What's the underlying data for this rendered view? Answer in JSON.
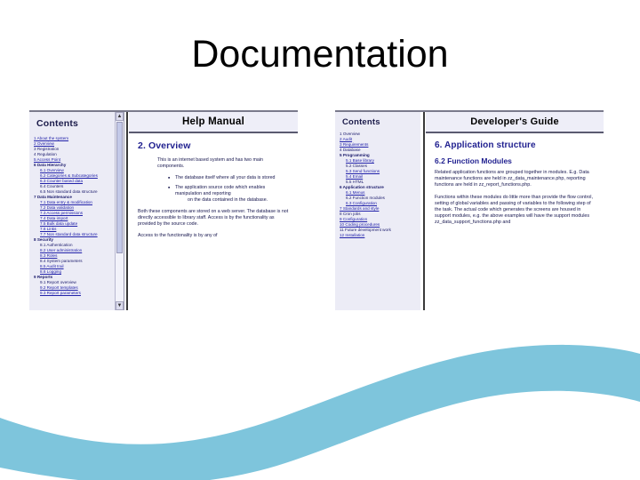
{
  "slide": {
    "title": "Documentation",
    "accent_color": "#7ec5dc",
    "heading_color": "#1f1f8f"
  },
  "left_screenshot": {
    "name": "help-manual-window",
    "sidebar": {
      "title": "Contents",
      "items": [
        {
          "label": "1 About the system",
          "link": true,
          "level": 1
        },
        {
          "label": "2 Overview",
          "link": true,
          "level": 1
        },
        {
          "label": "3 Registration",
          "link": false,
          "level": 1
        },
        {
          "label": "4 Regulation",
          "link": false,
          "level": 1
        },
        {
          "label": "5 Access Point",
          "link": true,
          "level": 1
        },
        {
          "label": "6 Data Hierarchy",
          "link": false,
          "level": 1,
          "header": true
        },
        {
          "label": "6.1 Overview",
          "link": true,
          "level": 2
        },
        {
          "label": "6.2 Categories & Subcategories",
          "link": true,
          "level": 2
        },
        {
          "label": "6.3 Counter based data",
          "link": true,
          "level": 2
        },
        {
          "label": "6.4 Counters",
          "link": false,
          "level": 2
        },
        {
          "label": "6.5 Non standard data structure",
          "link": false,
          "level": 2
        },
        {
          "label": "7 Data Maintenance",
          "link": false,
          "level": 1,
          "header": true
        },
        {
          "label": "7.1 Data entry & modification",
          "link": true,
          "level": 2
        },
        {
          "label": "7.2 Data validation",
          "link": true,
          "level": 2
        },
        {
          "label": "7.3 Access permissions",
          "link": true,
          "level": 2
        },
        {
          "label": "7.4 Data import",
          "link": true,
          "level": 2
        },
        {
          "label": "7.5 Bulk data update",
          "link": true,
          "level": 2
        },
        {
          "label": "7.6 Links",
          "link": true,
          "level": 2
        },
        {
          "label": "7.7 Non standard data structure",
          "link": true,
          "level": 2
        },
        {
          "label": "8 Security",
          "link": false,
          "level": 1,
          "header": true
        },
        {
          "label": "8.1 Authentication",
          "link": false,
          "level": 2
        },
        {
          "label": "8.2 User administration",
          "link": true,
          "level": 2
        },
        {
          "label": "8.3 Roles",
          "link": true,
          "level": 2
        },
        {
          "label": "8.4 System parameters",
          "link": false,
          "level": 2
        },
        {
          "label": "8.5 Audit trail",
          "link": true,
          "level": 2
        },
        {
          "label": "8.6 Logging",
          "link": true,
          "level": 2
        },
        {
          "label": "9 Reports",
          "link": false,
          "level": 1,
          "header": true
        },
        {
          "label": "9.1 Report overview",
          "link": false,
          "level": 2
        },
        {
          "label": "9.2 Report templates",
          "link": true,
          "level": 2
        },
        {
          "label": "9.3 Report parameters",
          "link": true,
          "level": 2
        }
      ]
    },
    "header_title": "Help Manual",
    "section_title": "2. Overview",
    "intro": "This is an internet based system and has two main components.",
    "bullets": [
      {
        "text": "The database itself where all your data is stored"
      },
      {
        "text": "The application source code which enables manipulation and reporting",
        "indent": "on the data contained in the database."
      }
    ],
    "paragraphs": [
      "Both these components are stored on a web server. The database is not directly accessible to library staff. Access is by the functionality as provided by the source code.",
      "Access to the functionality is by any of"
    ],
    "scrollbar": {
      "up": "▲",
      "down": "▼"
    }
  },
  "right_screenshot": {
    "name": "developers-guide-window",
    "sidebar": {
      "title": "Contents",
      "items": [
        {
          "label": "1 Overview",
          "link": false,
          "level": 1
        },
        {
          "label": "2 Audit",
          "link": true,
          "level": 1
        },
        {
          "label": "3 Requirements",
          "link": true,
          "level": 1
        },
        {
          "label": "4 Database",
          "link": false,
          "level": 1
        },
        {
          "label": "5 Programming",
          "link": false,
          "level": 1,
          "header": true
        },
        {
          "label": "5.1 Base library",
          "link": true,
          "level": 2
        },
        {
          "label": "5.2 Classes",
          "link": false,
          "level": 2
        },
        {
          "label": "5.3 Send functions",
          "link": true,
          "level": 2
        },
        {
          "label": "5.4 Email",
          "link": true,
          "level": 2
        },
        {
          "label": "5.5 HTML",
          "link": false,
          "level": 2
        },
        {
          "label": "6 Application structure",
          "link": false,
          "level": 1,
          "header": true
        },
        {
          "label": "6.1 Menus",
          "link": true,
          "level": 2
        },
        {
          "label": "6.2 Function modules",
          "link": false,
          "level": 2
        },
        {
          "label": "6.3 Configuration",
          "link": true,
          "level": 2
        },
        {
          "label": "7 Standards and style",
          "link": true,
          "level": 1
        },
        {
          "label": "8 Cron jobs",
          "link": false,
          "level": 1
        },
        {
          "label": "9 Configuration",
          "link": true,
          "level": 1
        },
        {
          "label": "10 Coding procedures",
          "link": true,
          "level": 1
        },
        {
          "label": "11 Future development work",
          "link": false,
          "level": 1
        },
        {
          "label": "12 Installation",
          "link": true,
          "level": 1
        }
      ]
    },
    "header_title": "Developer's Guide",
    "section_title": "6. Application structure",
    "sub_title": "6.2 Function Modules",
    "paragraphs": [
      "Related application functions are grouped together in modules. E.g. Data maintenance functions are held in zz_data_maintenance.php, reporting functions are held in zz_report_functions.php.",
      "Functions within these modules do little more than provide the flow control, setting of global variables and passing of variables to the following step of the task. The actual code which generates the screens are housed in support modules, e.g. the above examples will have the support modules zz_data_support_functions.php and"
    ]
  }
}
